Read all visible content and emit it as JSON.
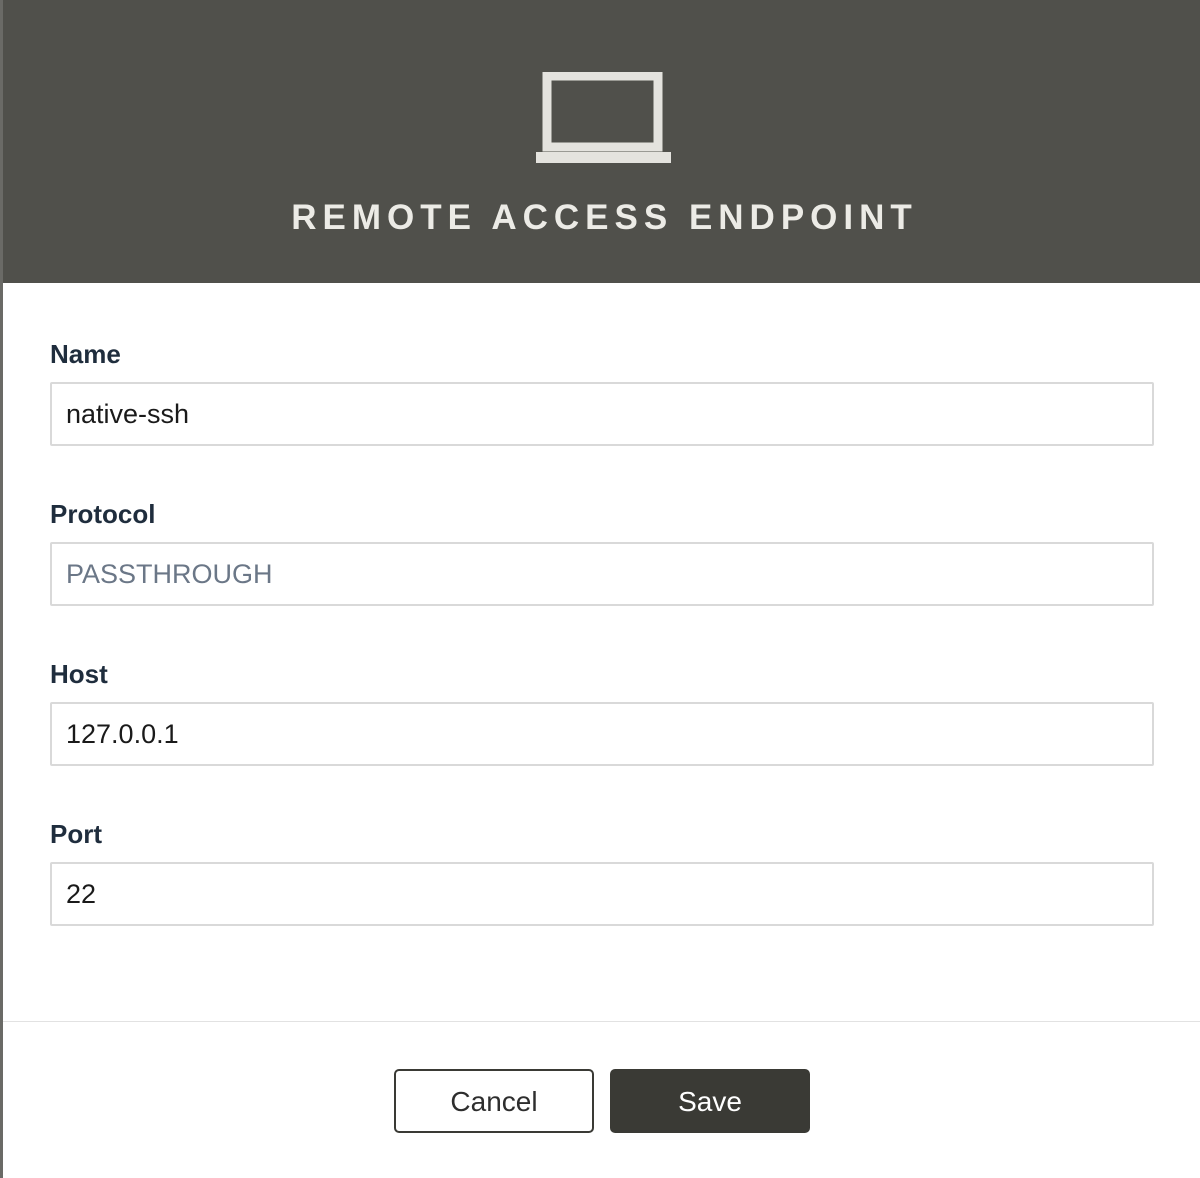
{
  "dialog": {
    "title": "REMOTE ACCESS ENDPOINT",
    "icon": "laptop-icon",
    "header_color": "#50504b"
  },
  "form": {
    "name": {
      "label": "Name",
      "value": "native-ssh"
    },
    "protocol": {
      "label": "Protocol",
      "value": "PASSTHROUGH"
    },
    "host": {
      "label": "Host",
      "value": "127.0.0.1"
    },
    "port": {
      "label": "Port",
      "value": "22"
    }
  },
  "actions": {
    "cancel_label": "Cancel",
    "save_label": "Save",
    "primary_color": "#3a3a35"
  }
}
